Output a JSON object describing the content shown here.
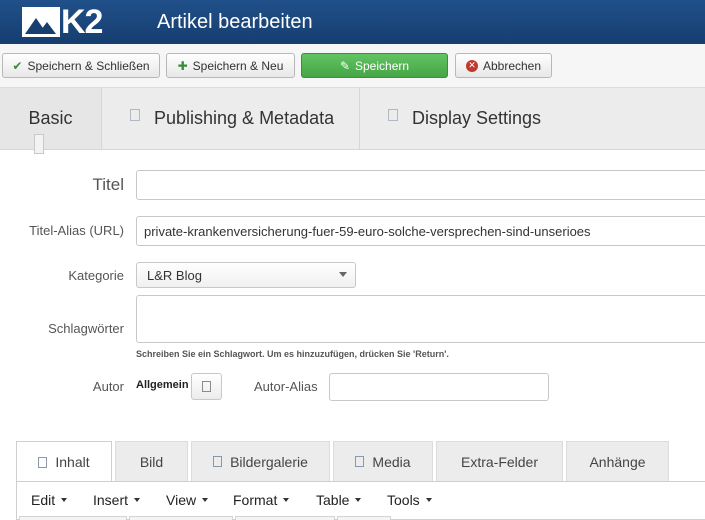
{
  "header": {
    "logo_text": "K2",
    "title": "Artikel bearbeiten"
  },
  "toolbar": {
    "save_close": {
      "label": "Speichern & Schließen",
      "icon": "check-icon"
    },
    "save_new": {
      "label": "Speichern & Neu",
      "icon": "plus-icon"
    },
    "save": {
      "label": "Speichern",
      "icon": "edit-icon"
    },
    "cancel": {
      "label": "Abbrechen",
      "icon": "cancel-circle-icon"
    }
  },
  "main_tabs": [
    {
      "label": "Basic"
    },
    {
      "label": "Publishing & Metadata"
    },
    {
      "label": "Display Settings"
    }
  ],
  "form": {
    "title_label": "Titel",
    "title_value": "",
    "alias_label": "Titel-Alias (URL)",
    "alias_value": "private-krankenversicherung-fuer-59-euro-solche-versprechen-sind-unserioes",
    "category_label": "Kategorie",
    "category_value": "L&R Blog",
    "tags_label": "Schlagwörter",
    "tags_help": "Schreiben Sie ein Schlagwort. Um es hinzuzufügen, drücken Sie 'Return'.",
    "author_label": "Autor",
    "author_value": "Allgemein",
    "author_alias_label": "Autor-Alias",
    "author_alias_value": ""
  },
  "content_tabs": [
    {
      "label": "Inhalt",
      "active": true
    },
    {
      "label": "Bild"
    },
    {
      "label": "Bildergalerie"
    },
    {
      "label": "Media"
    },
    {
      "label": "Extra-Felder"
    },
    {
      "label": "Anhänge"
    }
  ],
  "editor_menu": [
    "Edit",
    "Insert",
    "View",
    "Format",
    "Table",
    "Tools"
  ],
  "colors": {
    "header_bg": "#163e6f",
    "save_button": "#46a546",
    "cancel_icon": "#c0392b"
  }
}
